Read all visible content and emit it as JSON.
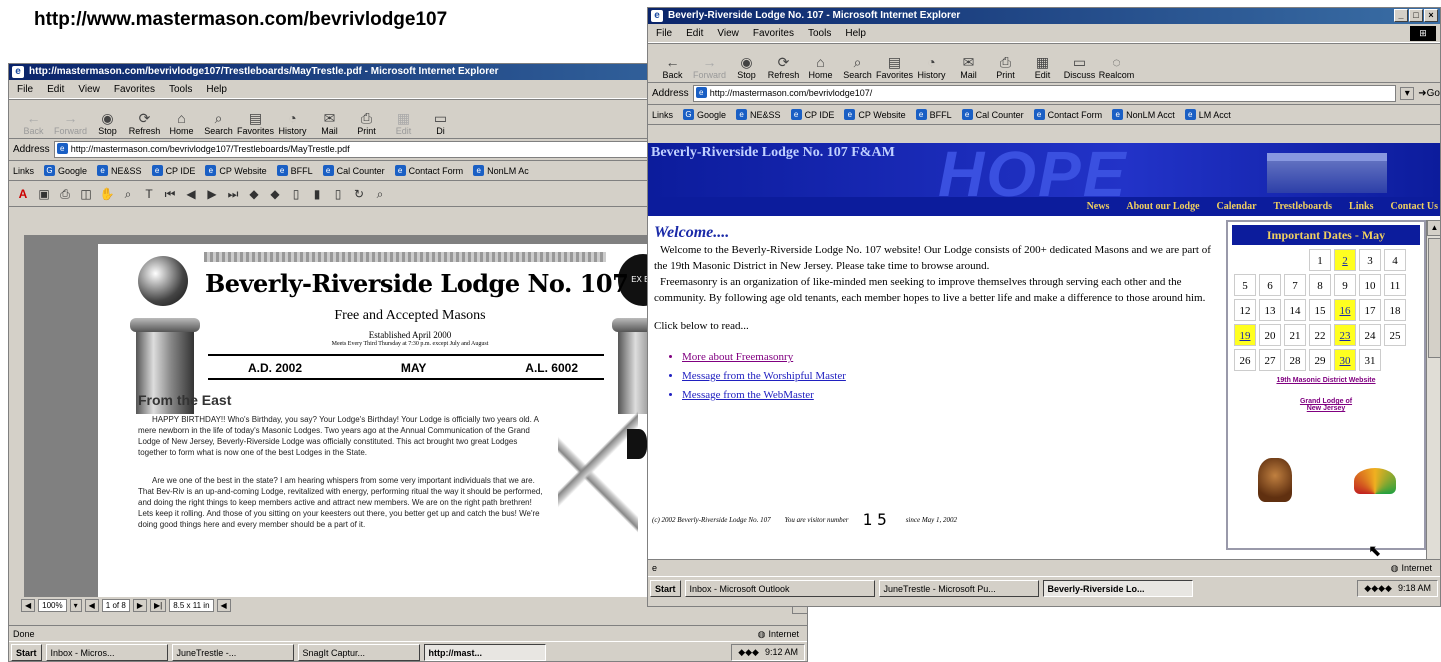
{
  "caption_url": "http://www.mastermason.com/bevrivlodge107",
  "left_window": {
    "title": "http://mastermason.com/bevrivlodge107/Trestleboards/MayTrestle.pdf - Microsoft Internet Explorer",
    "menu": [
      "File",
      "Edit",
      "View",
      "Favorites",
      "Tools",
      "Help"
    ],
    "toolbar": [
      "Back",
      "Forward",
      "Stop",
      "Refresh",
      "Home",
      "Search",
      "Favorites",
      "History",
      "Mail",
      "Print",
      "Edit",
      "Di"
    ],
    "address_label": "Address",
    "address_value": "http://mastermason.com/bevrivlodge107/Trestleboards/MayTrestle.pdf",
    "links_label": "Links",
    "links": [
      "Google",
      "NE&SS",
      "CP IDE",
      "CP Website",
      "BFFL",
      "Cal Counter",
      "Contact Form",
      "NonLM Ac"
    ],
    "pdf": {
      "title": "Beverly-Riverside Lodge No. 107",
      "subtitle": "Free and Accepted Masons",
      "established": "Established April 2000",
      "meets": "Meets Every Third Thursday at 7:30 p.m. except July and August",
      "ad": "A.D. 2002",
      "month": "MAY",
      "al": "A.L. 6002",
      "section_heading": "From the East",
      "para1": "HAPPY BIRTHDAY!! Who's Birthday, you say? Your Lodge's Birthday! Your Lodge is officially two years old. A mere newborn in the life of today's Masonic Lodges. Two years ago at the Annual Communication of the Grand Lodge of New Jersey, Beverly-Riverside Lodge was officially constituted. This act brought two great Lodges together to form what is now one of the best Lodges in the State.",
      "para2": "Are we one of the best in the state? I am hearing whispers from some very important individuals that we are. That Bev-Riv is an up-and-coming Lodge, revitalized with energy, performing ritual the way it should be performed, and doing the right things to keep members active and attract new members. We are on the right path brethren! Lets keep it rolling. And those of you sitting on your keesters out there, you better get up and catch the bus! We're doing good things here and every member should be a part of it.",
      "seal_text": "EX BE"
    },
    "nav": {
      "zoom": "100%",
      "page": "1 of 8",
      "size": "8.5 x 11 in"
    },
    "status": "Done",
    "zone": "Internet",
    "taskbar": {
      "start": "Start",
      "tasks": [
        "Inbox - Micros...",
        "JuneTrestle -...",
        "SnagIt Captur...",
        "http://mast..."
      ],
      "clock": "9:12 AM"
    }
  },
  "right_window": {
    "title": "Beverly-Riverside Lodge No. 107 - Microsoft Internet Explorer",
    "menu": [
      "File",
      "Edit",
      "View",
      "Favorites",
      "Tools",
      "Help"
    ],
    "toolbar": [
      "Back",
      "Forward",
      "Stop",
      "Refresh",
      "Home",
      "Search",
      "Favorites",
      "History",
      "Mail",
      "Print",
      "Edit",
      "Discuss",
      "Realcom"
    ],
    "address_label": "Address",
    "address_value": "http://mastermason.com/bevrivlodge107/",
    "go": "Go",
    "links_label": "Links",
    "links": [
      "Google",
      "NE&SS",
      "CP IDE",
      "CP Website",
      "BFFL",
      "Cal Counter",
      "Contact Form",
      "NonLM Acct",
      "LM Acct"
    ],
    "site": {
      "banner_title": "Beverly-Riverside Lodge No. 107 F&AM",
      "banner_watermark": "HOPE",
      "nav": [
        "News",
        "About our Lodge",
        "Calendar",
        "Trestleboards",
        "Links",
        "Contact Us"
      ],
      "welcome": "Welcome....",
      "para1": "Welcome to the Beverly-Riverside Lodge No. 107 website! Our Lodge consists of 200+ dedicated Masons and we are part of the 19th Masonic District in New Jersey. Please take time to browse around.",
      "para2": "Freemasonry is an organization of like-minded men seeking to improve themselves through serving each other and the community. By following age old tenants, each member hopes to live a better life and make a difference to those around him.",
      "click_text": "Click below to read...",
      "links": [
        "More about Freemasonry",
        "Message from the Worshipful Master",
        "Message from the WebMaster"
      ],
      "footer_copy": "(c) 2002 Beverly-Riverside Lodge No. 107",
      "footer_visitor": "You are visitor number",
      "counter": "15",
      "footer_since": "since May 1, 2002",
      "dates_title": "Important Dates - May",
      "calendar": [
        "",
        "",
        "",
        "1",
        "2",
        "3",
        "4",
        "5",
        "6",
        "7",
        "8",
        "9",
        "10",
        "11",
        "12",
        "13",
        "14",
        "15",
        "16",
        "17",
        "18",
        "19",
        "20",
        "21",
        "22",
        "23",
        "24",
        "25",
        "26",
        "27",
        "28",
        "29",
        "30",
        "31",
        ""
      ],
      "highlighted_dates": [
        "2",
        "16",
        "19",
        "23",
        "30"
      ],
      "side_link1": "19th Masonic District Website",
      "side_link2": "Grand Lodge of New Jersey"
    },
    "status": "",
    "zone": "Internet",
    "taskbar": {
      "start": "Start",
      "tasks": [
        "Inbox - Microsoft Outlook",
        "JuneTrestle - Microsoft Pu...",
        "Beverly-Riverside Lo..."
      ],
      "clock": "9:18 AM"
    }
  },
  "colors": {
    "site_blue": "#0c1c9c",
    "nav_gold": "#f0d060",
    "highlight_yellow": "#ffff20"
  }
}
